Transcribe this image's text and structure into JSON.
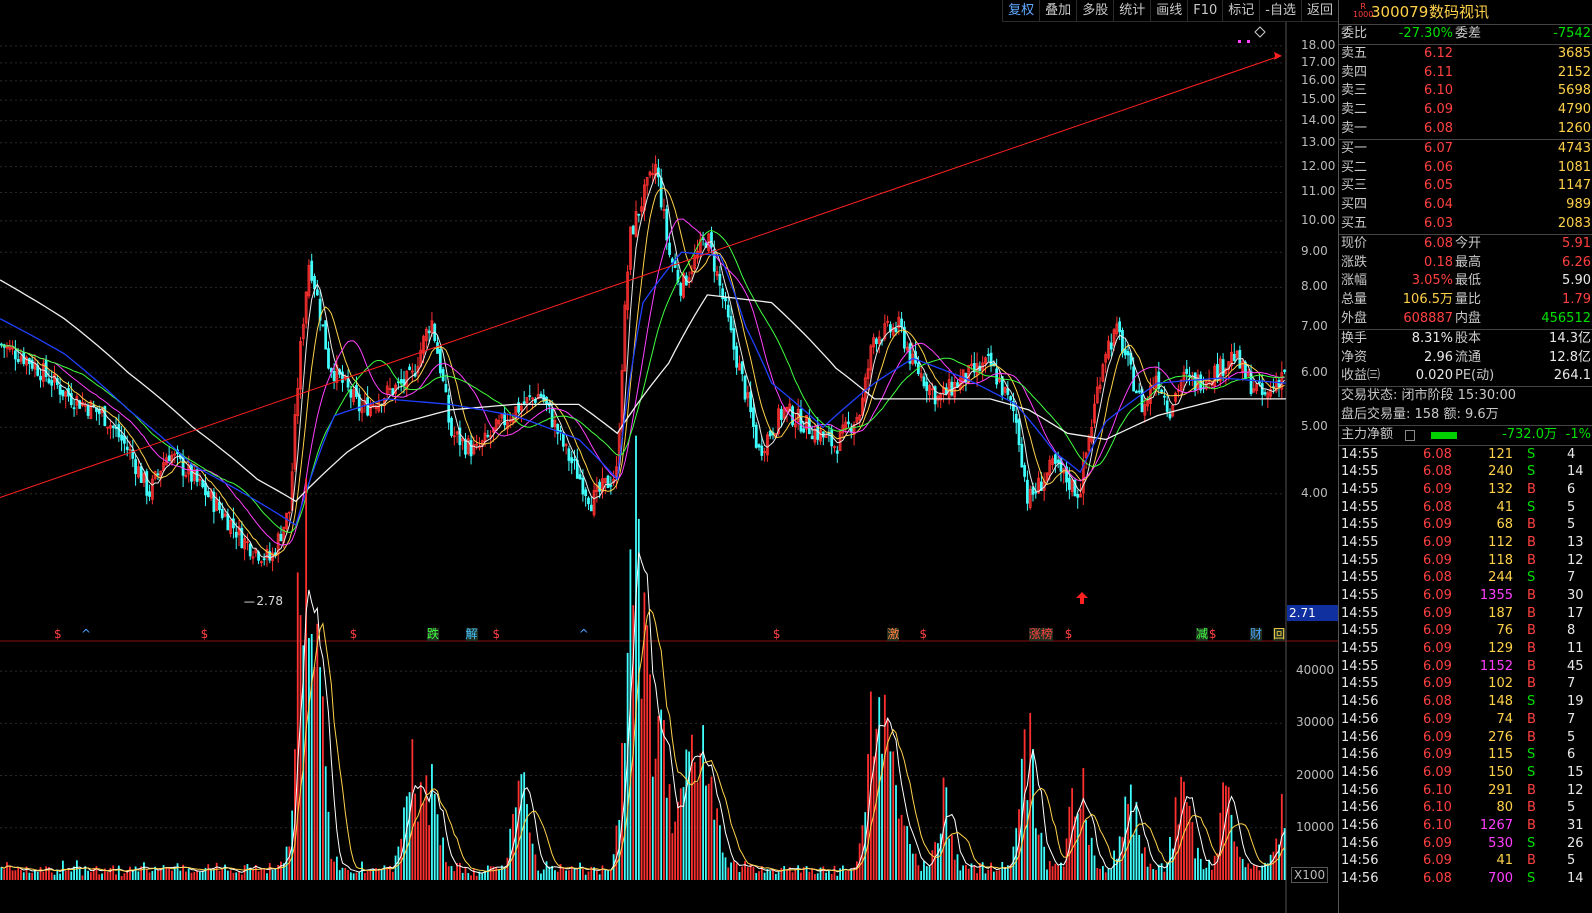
{
  "toolbar": {
    "items": [
      "复权",
      "叠加",
      "多股",
      "统计",
      "画线",
      "F10",
      "标记",
      "-自选",
      "返回"
    ],
    "active": 0
  },
  "stock": {
    "code": "300079",
    "name": "数码视讯",
    "badge_top": "R",
    "badge_bottom": "1000"
  },
  "weibi": {
    "label": "委比",
    "value": "-27.30%",
    "diff_label": "委差",
    "diff": "-7542"
  },
  "asks": [
    {
      "label": "卖五",
      "price": "6.12",
      "vol": "3685"
    },
    {
      "label": "卖四",
      "price": "6.11",
      "vol": "2152"
    },
    {
      "label": "卖三",
      "price": "6.10",
      "vol": "5698"
    },
    {
      "label": "卖二",
      "price": "6.09",
      "vol": "4790"
    },
    {
      "label": "卖一",
      "price": "6.08",
      "vol": "1260"
    }
  ],
  "bids": [
    {
      "label": "买一",
      "price": "6.07",
      "vol": "4743"
    },
    {
      "label": "买二",
      "price": "6.06",
      "vol": "1081"
    },
    {
      "label": "买三",
      "price": "6.05",
      "vol": "1147"
    },
    {
      "label": "买四",
      "price": "6.04",
      "vol": "989"
    },
    {
      "label": "买五",
      "price": "6.03",
      "vol": "2083"
    }
  ],
  "quote": [
    {
      "l1": "现价",
      "v1": "6.08",
      "c1": "red",
      "l2": "今开",
      "v2": "5.91",
      "c2": "red"
    },
    {
      "l1": "涨跌",
      "v1": "0.18",
      "c1": "red",
      "l2": "最高",
      "v2": "6.26",
      "c2": "red"
    },
    {
      "l1": "涨幅",
      "v1": "3.05%",
      "c1": "red",
      "l2": "最低",
      "v2": "5.90",
      "c2": "white"
    },
    {
      "l1": "总量",
      "v1": "106.5万",
      "c1": "yellow",
      "l2": "量比",
      "v2": "1.79",
      "c2": "red"
    },
    {
      "l1": "外盘",
      "v1": "608887",
      "c1": "red",
      "l2": "内盘",
      "v2": "456512",
      "c2": "green"
    }
  ],
  "fundamentals": [
    {
      "l1": "换手",
      "v1": "8.31%",
      "l2": "股本",
      "v2": "14.3亿"
    },
    {
      "l1": "净资",
      "v1": "2.96",
      "l2": "流通",
      "v2": "12.8亿"
    },
    {
      "l1": "收益㈢",
      "v1": "0.020",
      "l2": "PE(动)",
      "v2": "264.1"
    }
  ],
  "status": {
    "trade": "交易状态: 闭市阶段 15:30:00",
    "after": "盘后交易量: 158  额: 9.6万"
  },
  "main_flow": {
    "label": "主力净额",
    "value": "-732.0万",
    "pct": "-1%"
  },
  "ticks": [
    {
      "t": "14:55",
      "p": "6.08",
      "v": "121",
      "d": "S",
      "n": "4"
    },
    {
      "t": "14:55",
      "p": "6.08",
      "v": "240",
      "d": "S",
      "n": "14"
    },
    {
      "t": "14:55",
      "p": "6.09",
      "v": "132",
      "d": "B",
      "n": "6"
    },
    {
      "t": "14:55",
      "p": "6.08",
      "v": "41",
      "d": "S",
      "n": "5"
    },
    {
      "t": "14:55",
      "p": "6.09",
      "v": "68",
      "d": "B",
      "n": "5"
    },
    {
      "t": "14:55",
      "p": "6.09",
      "v": "112",
      "d": "B",
      "n": "13"
    },
    {
      "t": "14:55",
      "p": "6.09",
      "v": "118",
      "d": "B",
      "n": "12"
    },
    {
      "t": "14:55",
      "p": "6.08",
      "v": "244",
      "d": "S",
      "n": "7"
    },
    {
      "t": "14:55",
      "p": "6.09",
      "v": "1355",
      "d": "B",
      "n": "30"
    },
    {
      "t": "14:55",
      "p": "6.09",
      "v": "187",
      "d": "B",
      "n": "17"
    },
    {
      "t": "14:55",
      "p": "6.09",
      "v": "76",
      "d": "B",
      "n": "8"
    },
    {
      "t": "14:55",
      "p": "6.09",
      "v": "129",
      "d": "B",
      "n": "11"
    },
    {
      "t": "14:55",
      "p": "6.09",
      "v": "1152",
      "d": "B",
      "n": "45"
    },
    {
      "t": "14:55",
      "p": "6.09",
      "v": "102",
      "d": "B",
      "n": "7"
    },
    {
      "t": "14:56",
      "p": "6.08",
      "v": "148",
      "d": "S",
      "n": "19"
    },
    {
      "t": "14:56",
      "p": "6.09",
      "v": "74",
      "d": "B",
      "n": "7"
    },
    {
      "t": "14:56",
      "p": "6.09",
      "v": "276",
      "d": "B",
      "n": "5"
    },
    {
      "t": "14:56",
      "p": "6.09",
      "v": "115",
      "d": "S",
      "n": "6"
    },
    {
      "t": "14:56",
      "p": "6.09",
      "v": "150",
      "d": "S",
      "n": "15"
    },
    {
      "t": "14:56",
      "p": "6.10",
      "v": "291",
      "d": "B",
      "n": "12"
    },
    {
      "t": "14:56",
      "p": "6.10",
      "v": "80",
      "d": "B",
      "n": "5"
    },
    {
      "t": "14:56",
      "p": "6.10",
      "v": "1267",
      "d": "B",
      "n": "31"
    },
    {
      "t": "14:56",
      "p": "6.09",
      "v": "530",
      "d": "S",
      "n": "26"
    },
    {
      "t": "14:56",
      "p": "6.09",
      "v": "41",
      "d": "B",
      "n": "5"
    },
    {
      "t": "14:56",
      "p": "6.08",
      "v": "700",
      "d": "S",
      "n": "14"
    }
  ],
  "chart_data": {
    "type": "candlestick",
    "price_axis": {
      "ticks": [
        "18.00",
        "17.00",
        "16.00",
        "15.00",
        "14.00",
        "13.00",
        "12.00",
        "11.00",
        "10.00",
        "9.00",
        "8.00",
        "7.00",
        "6.00",
        "5.00",
        "4.00"
      ],
      "scale": "log",
      "range": [
        2.6,
        19.5
      ]
    },
    "volume_axis": {
      "ticks": [
        "40000",
        "30000",
        "20000",
        "10000"
      ],
      "unit": "X100",
      "range": [
        0,
        45000
      ]
    },
    "low_label": "2.78",
    "current_price_tag": "2.71",
    "trendline": {
      "from": 3.95,
      "to": 17.4,
      "touch": 12.1
    },
    "price_path": [
      [
        0,
        6.6
      ],
      [
        0.02,
        6.3
      ],
      [
        0.05,
        5.6
      ],
      [
        0.08,
        5.2
      ],
      [
        0.1,
        4.6
      ],
      [
        0.115,
        4.0
      ],
      [
        0.13,
        4.6
      ],
      [
        0.15,
        4.2
      ],
      [
        0.17,
        3.8
      ],
      [
        0.19,
        3.4
      ],
      [
        0.21,
        3.2
      ],
      [
        0.225,
        3.8
      ],
      [
        0.24,
        8.8
      ],
      [
        0.255,
        6.2
      ],
      [
        0.28,
        5.3
      ],
      [
        0.3,
        5.6
      ],
      [
        0.32,
        5.9
      ],
      [
        0.335,
        7.2
      ],
      [
        0.35,
        4.9
      ],
      [
        0.37,
        4.6
      ],
      [
        0.4,
        5.3
      ],
      [
        0.42,
        5.6
      ],
      [
        0.44,
        4.6
      ],
      [
        0.46,
        3.9
      ],
      [
        0.48,
        4.3
      ],
      [
        0.49,
        9.5
      ],
      [
        0.5,
        10.8
      ],
      [
        0.51,
        12.0
      ],
      [
        0.52,
        9.0
      ],
      [
        0.53,
        8.0
      ],
      [
        0.55,
        9.5
      ],
      [
        0.56,
        8.0
      ],
      [
        0.57,
        6.6
      ],
      [
        0.59,
        4.6
      ],
      [
        0.61,
        5.3
      ],
      [
        0.63,
        5.0
      ],
      [
        0.65,
        4.7
      ],
      [
        0.67,
        5.3
      ],
      [
        0.68,
        6.8
      ],
      [
        0.7,
        7.0
      ],
      [
        0.71,
        6.2
      ],
      [
        0.73,
        5.5
      ],
      [
        0.75,
        5.9
      ],
      [
        0.77,
        6.2
      ],
      [
        0.79,
        5.2
      ],
      [
        0.8,
        3.9
      ],
      [
        0.82,
        4.4
      ],
      [
        0.84,
        4.0
      ],
      [
        0.85,
        5.1
      ],
      [
        0.86,
        6.5
      ],
      [
        0.87,
        6.9
      ],
      [
        0.88,
        6.0
      ],
      [
        0.89,
        5.3
      ],
      [
        0.9,
        6.0
      ],
      [
        0.91,
        5.3
      ],
      [
        0.92,
        5.9
      ],
      [
        0.93,
        5.8
      ],
      [
        0.95,
        6.1
      ],
      [
        0.96,
        6.4
      ],
      [
        0.97,
        5.9
      ],
      [
        0.985,
        5.5
      ],
      [
        1.0,
        6.08
      ]
    ],
    "ma_white": [
      [
        0,
        8.2
      ],
      [
        0.05,
        7.2
      ],
      [
        0.1,
        6.0
      ],
      [
        0.15,
        5.0
      ],
      [
        0.2,
        4.2
      ],
      [
        0.23,
        3.9
      ],
      [
        0.27,
        4.6
      ],
      [
        0.3,
        5.0
      ],
      [
        0.35,
        5.3
      ],
      [
        0.4,
        5.4
      ],
      [
        0.45,
        5.4
      ],
      [
        0.48,
        4.9
      ],
      [
        0.52,
        6.2
      ],
      [
        0.55,
        7.8
      ],
      [
        0.6,
        7.6
      ],
      [
        0.65,
        6.1
      ],
      [
        0.68,
        5.5
      ],
      [
        0.72,
        5.5
      ],
      [
        0.77,
        5.5
      ],
      [
        0.8,
        5.3
      ],
      [
        0.83,
        4.9
      ],
      [
        0.86,
        4.8
      ],
      [
        0.9,
        5.2
      ],
      [
        0.95,
        5.5
      ],
      [
        1.0,
        5.5
      ]
    ],
    "ma_blue": [
      [
        0,
        7.2
      ],
      [
        0.05,
        6.4
      ],
      [
        0.1,
        5.3
      ],
      [
        0.15,
        4.4
      ],
      [
        0.2,
        3.9
      ],
      [
        0.23,
        3.6
      ],
      [
        0.26,
        5.2
      ],
      [
        0.3,
        5.5
      ],
      [
        0.35,
        5.4
      ],
      [
        0.4,
        5.2
      ],
      [
        0.45,
        4.8
      ],
      [
        0.48,
        4.2
      ],
      [
        0.5,
        7.6
      ],
      [
        0.53,
        9.0
      ],
      [
        0.56,
        8.9
      ],
      [
        0.58,
        7.0
      ],
      [
        0.6,
        5.8
      ],
      [
        0.64,
        5.0
      ],
      [
        0.68,
        5.8
      ],
      [
        0.71,
        6.3
      ],
      [
        0.75,
        5.9
      ],
      [
        0.79,
        5.4
      ],
      [
        0.82,
        4.6
      ],
      [
        0.84,
        4.3
      ],
      [
        0.86,
        5.1
      ],
      [
        0.9,
        5.8
      ],
      [
        0.95,
        5.9
      ],
      [
        1.0,
        5.8
      ]
    ],
    "markers": [
      {
        "label": "$",
        "pos": 0.042,
        "c": "#ff4040"
      },
      {
        "label": "^",
        "pos": 0.063,
        "c": "#4aa0ff"
      },
      {
        "label": "$",
        "pos": 0.156,
        "c": "#ff4040"
      },
      {
        "label": "$",
        "pos": 0.272,
        "c": "#ff4040"
      },
      {
        "label": "跌",
        "pos": 0.332,
        "c": "#40ff40"
      },
      {
        "label": "解",
        "pos": 0.362,
        "c": "#40c0ff"
      },
      {
        "label": "$",
        "pos": 0.383,
        "c": "#ff4040"
      },
      {
        "label": "^",
        "pos": 0.45,
        "c": "#4aa0ff"
      },
      {
        "label": "$",
        "pos": 0.601,
        "c": "#ff4040"
      },
      {
        "label": "激",
        "pos": 0.69,
        "c": "#ff8040"
      },
      {
        "label": "$",
        "pos": 0.715,
        "c": "#ff4040"
      },
      {
        "label": "涨榜",
        "pos": 0.8,
        "c": "#ff4040"
      },
      {
        "label": "$",
        "pos": 0.828,
        "c": "#ff4040"
      },
      {
        "label": "减",
        "pos": 0.93,
        "c": "#40ff40"
      },
      {
        "label": "$",
        "pos": 0.94,
        "c": "#ff4040"
      },
      {
        "label": "财",
        "pos": 0.972,
        "c": "#4aa0ff"
      },
      {
        "label": "回",
        "pos": 0.99,
        "c": "#ffd24a"
      }
    ],
    "volume_peaks": [
      [
        0.235,
        40000
      ],
      [
        0.24,
        33000
      ],
      [
        0.245,
        28000
      ],
      [
        0.32,
        19000
      ],
      [
        0.335,
        16000
      ],
      [
        0.405,
        17000
      ],
      [
        0.49,
        30000
      ],
      [
        0.495,
        33000
      ],
      [
        0.5,
        27000
      ],
      [
        0.515,
        26000
      ],
      [
        0.535,
        20000
      ],
      [
        0.55,
        22000
      ],
      [
        0.68,
        25000
      ],
      [
        0.685,
        18000
      ],
      [
        0.7,
        19000
      ],
      [
        0.735,
        14000
      ],
      [
        0.8,
        26000
      ],
      [
        0.84,
        19000
      ],
      [
        0.88,
        15000
      ],
      [
        0.92,
        18000
      ],
      [
        0.955,
        13000
      ],
      [
        0.998,
        11000
      ]
    ]
  }
}
